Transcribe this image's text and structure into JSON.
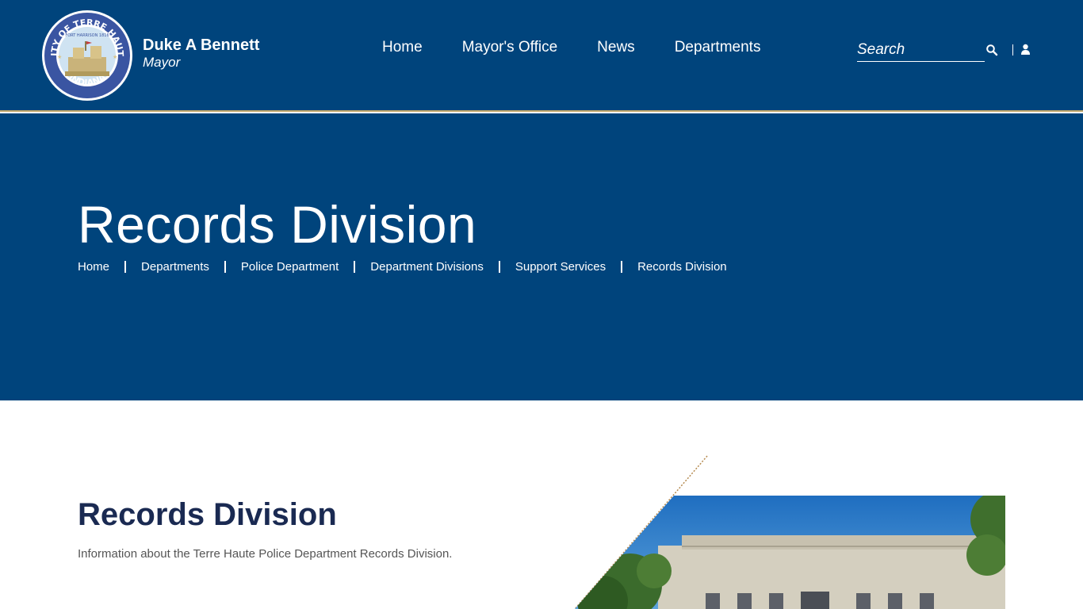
{
  "header": {
    "seal_text_top": "CITY OF TERRE HAUTE",
    "seal_text_bottom": "INDIANA",
    "seal_text_inner": "FORT HARRISON 1816",
    "name": "Duke A Bennett",
    "title": "Mayor",
    "nav": [
      {
        "label": "Home"
      },
      {
        "label": "Mayor's Office"
      },
      {
        "label": "News"
      },
      {
        "label": "Departments"
      }
    ],
    "search_placeholder": "Search"
  },
  "hero": {
    "title": "Records Division",
    "breadcrumb": [
      "Home",
      "Departments",
      "Police Department",
      "Department Divisions",
      "Support Services",
      "Records Division"
    ]
  },
  "content": {
    "title": "Records Division",
    "description": "Information about the Terre Haute Police Department Records Division."
  },
  "icons": {
    "search": "search-icon",
    "user": "user-icon"
  },
  "colors": {
    "primary": "#00447c",
    "gold": "#c2a86b",
    "heading": "#1a2a52"
  }
}
